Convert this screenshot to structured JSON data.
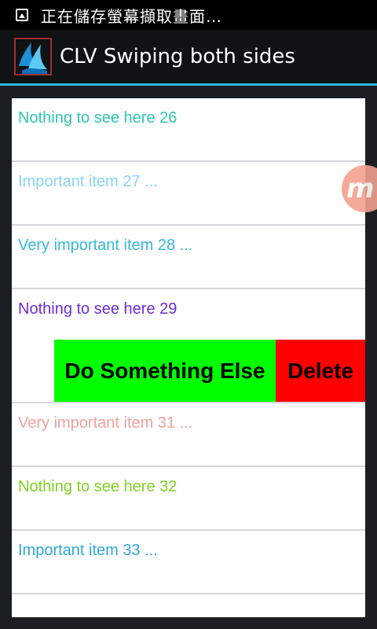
{
  "status_bar": {
    "notification_icon": "image-icon",
    "text": "正在儲存螢幕擷取畫面…"
  },
  "action_bar": {
    "app_icon": "droplet-logo-icon",
    "title": "CLV Swiping both sides",
    "accent_color": "#33b5e5"
  },
  "list": {
    "items": [
      {
        "label": "Nothing to see here 26",
        "color": "#2cc7b2"
      },
      {
        "label": "Important item 27 ...",
        "color": "#8ad3f5"
      },
      {
        "label": "Very important item 28 ...",
        "color": "#36b8d6"
      },
      {
        "label": "Nothing to see here 29",
        "color": "#6c2ed6"
      },
      {
        "label": "Very important item 31 ...",
        "color": "#f0a0a0"
      },
      {
        "label": "Nothing to see here 32",
        "color": "#7ed321"
      },
      {
        "label": "Important item 33 ...",
        "color": "#2ea6d9"
      }
    ],
    "swipe_actions": {
      "do_something_else": {
        "label": "Do Something Else",
        "color": "#00ff00"
      },
      "delete": {
        "label": "Delete",
        "color": "#ff0000"
      }
    }
  },
  "floating_button": {
    "icon": "m-logo-icon",
    "glyph": "m",
    "color": "#f3a08f"
  }
}
